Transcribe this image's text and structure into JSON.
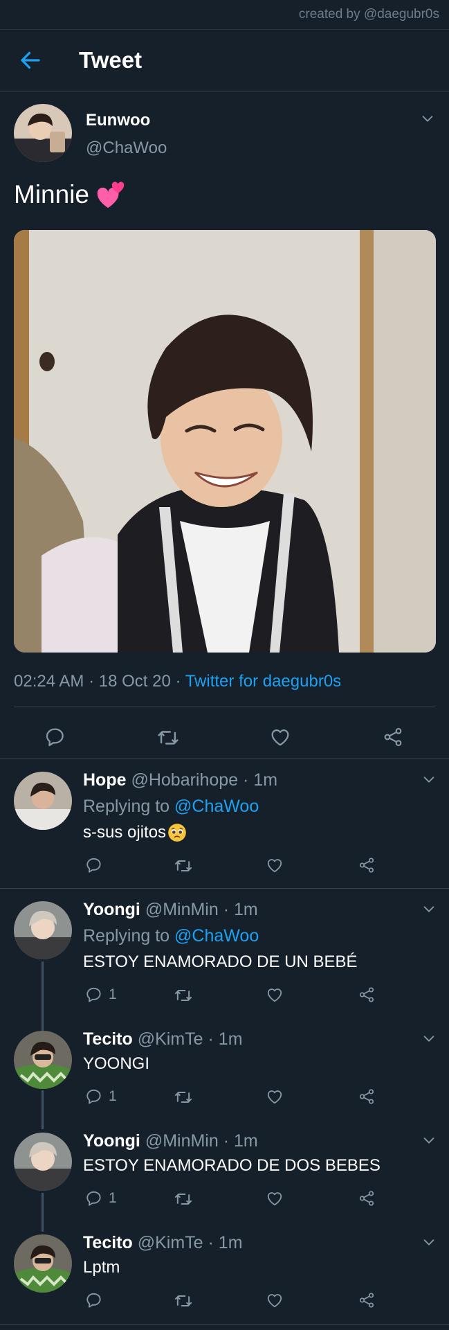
{
  "watermark": "created by @daegubr0s",
  "header": {
    "title": "Tweet"
  },
  "tweet": {
    "author_name": "Eunwoo",
    "author_handle": "@ChaWoo",
    "text": "Minnie",
    "time": "02:24 AM",
    "date": "18 Oct 20",
    "client": "Twitter for daegubr0s"
  },
  "replies": [
    {
      "name": "Hope",
      "handle": "@Hobarihope",
      "time": "1m",
      "replying_label": "Replying to",
      "replying_to": "@ChaWoo",
      "text": "s-sus ojitos",
      "reply_count": ""
    },
    {
      "name": "Yoongi",
      "handle": "@MinMin",
      "time": "1m",
      "replying_label": "Replying to",
      "replying_to": "@ChaWoo",
      "text": "ESTOY ENAMORADO DE UN BEBÉ",
      "reply_count": "1"
    },
    {
      "name": "Tecito",
      "handle": "@KimTe",
      "time": "1m",
      "text": "YOONGI",
      "reply_count": "1"
    },
    {
      "name": "Yoongi",
      "handle": "@MinMin",
      "time": "1m",
      "text": "ESTOY ENAMORADO DE DOS BEBES",
      "reply_count": "1"
    },
    {
      "name": "Tecito",
      "handle": "@KimTe",
      "time": "1m",
      "text": "Lptm",
      "reply_count": ""
    }
  ],
  "separator": "·",
  "colors": {
    "background": "#15202b",
    "accent": "#1da1f2",
    "muted": "#8899a6",
    "divider": "#38444d"
  }
}
